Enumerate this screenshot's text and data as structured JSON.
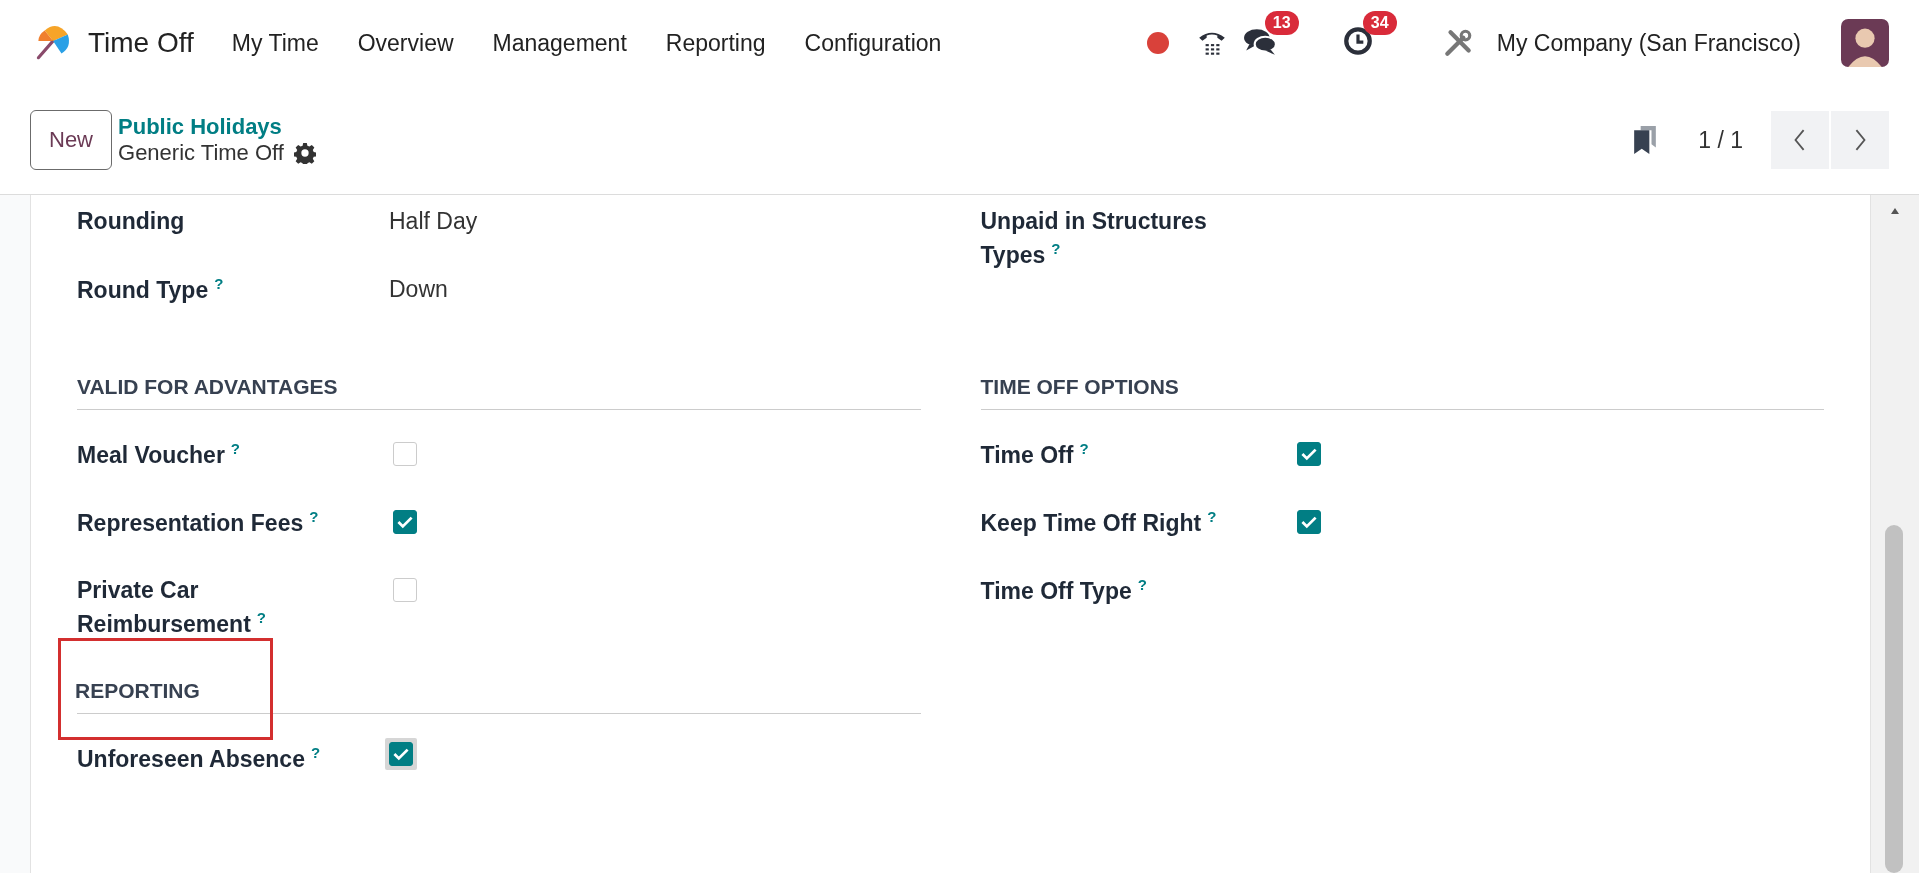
{
  "app": {
    "title": "Time Off"
  },
  "menu": [
    {
      "label": "My Time"
    },
    {
      "label": "Overview"
    },
    {
      "label": "Management"
    },
    {
      "label": "Reporting"
    },
    {
      "label": "Configuration"
    }
  ],
  "systray": {
    "messages_count": "13",
    "activities_count": "34",
    "company": "My Company (San Francisco)"
  },
  "control_panel": {
    "new_button": "New",
    "breadcrumb": "Public Holidays",
    "record_title": "Generic Time Off",
    "pager": "1 / 1"
  },
  "top_fields": {
    "left": [
      {
        "label": "Rounding",
        "value": "Half Day"
      },
      {
        "label": "Round Type",
        "help": "?",
        "value": "Down"
      }
    ],
    "right": [
      {
        "label": "Unpaid in Structures Types",
        "help": "?"
      }
    ]
  },
  "sections": [
    {
      "title": "VALID FOR ADVANTAGES",
      "highlighted": false,
      "fields": [
        {
          "label": "Meal Voucher",
          "help": "?",
          "kind": "checkbox",
          "checked": false,
          "focused": false
        },
        {
          "label": "Representation Fees",
          "help": "?",
          "kind": "checkbox",
          "checked": true,
          "focused": false
        },
        {
          "label": "Private Car Reimbursement",
          "help": "?",
          "kind": "checkbox",
          "checked": false,
          "focused": false
        }
      ]
    },
    {
      "title": "TIME OFF OPTIONS",
      "highlighted": false,
      "fields": [
        {
          "label": "Time Off",
          "help": "?",
          "kind": "checkbox",
          "checked": true,
          "focused": false
        },
        {
          "label": "Keep Time Off Right",
          "help": "?",
          "kind": "checkbox",
          "checked": true,
          "focused": false
        },
        {
          "label": "Time Off Type",
          "help": "?",
          "kind": "empty"
        }
      ]
    },
    {
      "title": "REPORTING",
      "highlighted": true,
      "fields": [
        {
          "label": "Unforeseen Absence",
          "help": "?",
          "kind": "checkbox",
          "checked": true,
          "focused": true
        }
      ]
    }
  ]
}
